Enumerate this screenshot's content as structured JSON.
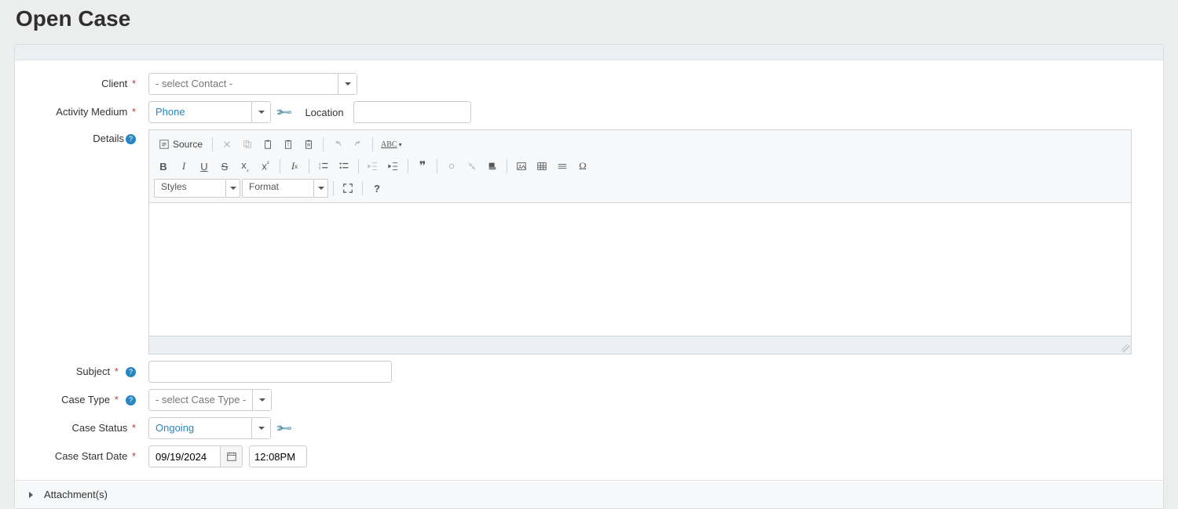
{
  "page": {
    "title": "Open Case"
  },
  "labels": {
    "client": "Client",
    "activity_medium": "Activity Medium",
    "location": "Location",
    "details": "Details",
    "subject": "Subject",
    "case_type": "Case Type",
    "case_status": "Case Status",
    "case_start_date": "Case Start Date",
    "attachments": "Attachment(s)"
  },
  "fields": {
    "client_placeholder": "- select Contact -",
    "activity_medium_value": "Phone",
    "location_value": "",
    "subject_value": "",
    "case_type_placeholder": "- select Case Type -",
    "case_status_value": "Ongoing",
    "start_date": "09/19/2024",
    "start_time": "12:08PM"
  },
  "editor": {
    "source_label": "Source",
    "styles_label": "Styles",
    "format_label": "Format"
  }
}
